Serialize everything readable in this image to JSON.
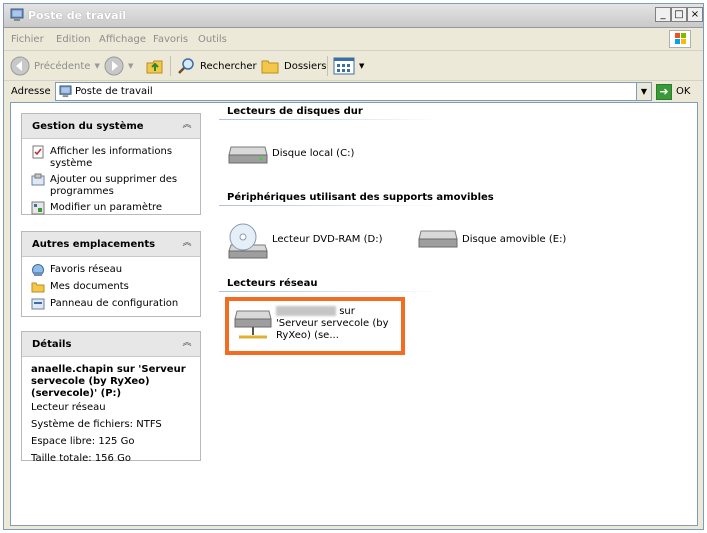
{
  "window": {
    "title": "Poste de travail",
    "buttons": {
      "minimize": "_",
      "maximize": "□",
      "close": "×"
    }
  },
  "menu": [
    "Fichier",
    "Edition",
    "Affichage",
    "Favoris",
    "Outils"
  ],
  "toolbar": {
    "back_label": "Précédente",
    "search_label": "Rechercher",
    "folders_label": "Dossiers"
  },
  "address": {
    "label": "Adresse",
    "value": "Poste de travail",
    "go_label": "OK"
  },
  "left_pane": {
    "system_tasks": {
      "title": "Gestion du système",
      "items": [
        {
          "label": "Afficher les informations système",
          "icon": "info-icon"
        },
        {
          "label": "Ajouter ou supprimer des programmes",
          "icon": "add-remove-icon"
        },
        {
          "label": "Modifier un paramètre",
          "icon": "settings-icon"
        }
      ]
    },
    "other_places": {
      "title": "Autres emplacements",
      "items": [
        {
          "label": "Favoris réseau",
          "icon": "network-icon"
        },
        {
          "label": "Mes documents",
          "icon": "folder-icon"
        },
        {
          "label": "Panneau de configuration",
          "icon": "control-panel-icon"
        }
      ]
    },
    "details": {
      "title": "Détails",
      "name": "anaelle.chapin sur 'Serveur servecole (by RyXeo) (servecole)' (P:)",
      "type": "Lecteur réseau",
      "filesystem": "Système de fichiers: NTFS",
      "free_space": "Espace libre: 125 Go",
      "total_size": "Taille totale: 156 Go"
    }
  },
  "groups": {
    "hard_disks": {
      "title": "Lecteurs de disques dur",
      "drives": [
        {
          "label": "Disque local (C:)"
        }
      ]
    },
    "removable": {
      "title": "Périphériques utilisant des supports amovibles",
      "drives": [
        {
          "label": "Lecteur DVD-RAM (D:)"
        },
        {
          "label": "Disque amovible (E:)"
        }
      ]
    },
    "network": {
      "title": "Lecteurs réseau",
      "drives": [
        {
          "label": "sur 'Serveur servecole (by RyXeo) (se..."
        }
      ]
    }
  },
  "colors": {
    "highlight_border": "#f26d21",
    "panel_header": "#e7e7e7"
  }
}
